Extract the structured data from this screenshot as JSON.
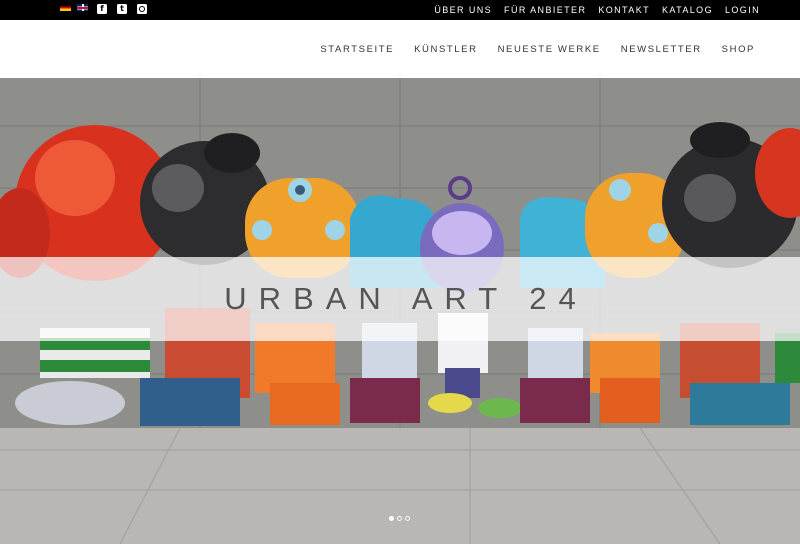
{
  "topbar": {
    "languages": [
      {
        "name": "de-flag-icon",
        "label": "Deutsch"
      },
      {
        "name": "uk-flag-icon",
        "label": "English"
      }
    ],
    "social": [
      {
        "name": "facebook-icon",
        "glyph": "f"
      },
      {
        "name": "twitter-icon",
        "glyph": "t"
      },
      {
        "name": "instagram-icon",
        "glyph": ""
      }
    ],
    "links": [
      "ÜBER UNS",
      "FÜR ANBIETER",
      "KONTAKT",
      "KATALOG",
      "LOGIN"
    ]
  },
  "header": {
    "nav": [
      "STARTSEITE",
      "KÜNSTLER",
      "NEUESTE WERKE",
      "NEWSLETTER",
      "SHOP"
    ]
  },
  "hero": {
    "title": "URBAN ART 24",
    "slides_total": 3,
    "active_slide": 1
  },
  "colors": {
    "topbar_bg": "#000000",
    "wall": "#8f8f8d",
    "pavement": "#b9b8b5"
  }
}
